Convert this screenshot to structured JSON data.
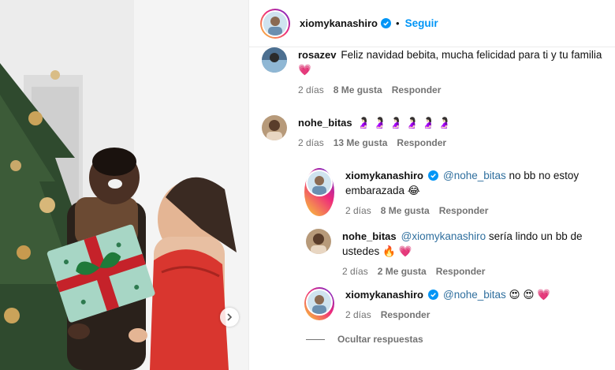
{
  "post": {
    "author": "xiomykanashiro",
    "follow_label": "Seguir",
    "dot": "•"
  },
  "comments": [
    {
      "username": "rosazev",
      "text": "Feliz navidad bebita, mucha felicidad para ti y tu familia",
      "emoji": "💗",
      "time": "2 días",
      "likes": "8 Me gusta",
      "reply_label": "Responder"
    },
    {
      "username": "nohe_bitas",
      "text": "",
      "emoji": "🤰🏻 🤰🏻 🤰🏻 🤰🏻 🤰🏻 🤰🏻",
      "time": "2 días",
      "likes": "13 Me gusta",
      "reply_label": "Responder"
    }
  ],
  "replies": [
    {
      "username": "xiomykanashiro",
      "mention": "@nohe_bitas",
      "text": "no bb no estoy embarazada",
      "emoji": "😂",
      "time": "2 días",
      "likes": "8 Me gusta",
      "reply_label": "Responder"
    },
    {
      "username": "nohe_bitas",
      "mention": "@xiomykanashiro",
      "text": "sería lindo un bb de ustedes",
      "emoji": "🔥 💗",
      "time": "2 días",
      "likes": "2 Me gusta",
      "reply_label": "Responder"
    },
    {
      "username": "xiomykanashiro",
      "mention": "@nohe_bitas",
      "text": "",
      "emoji": "😍 😍 💗",
      "time": "2 días",
      "likes": "",
      "reply_label": "Responder"
    }
  ],
  "hide_replies_label": "Ocultar respuestas",
  "colors": {
    "accent": "#0095f6",
    "muted": "#737373",
    "mention": "#2f6f9e",
    "verified": "#0095f6",
    "dress_red": "#d9362f"
  },
  "icons": {
    "verified": "verified-badge-icon",
    "carousel_next": "chevron-right-icon"
  }
}
